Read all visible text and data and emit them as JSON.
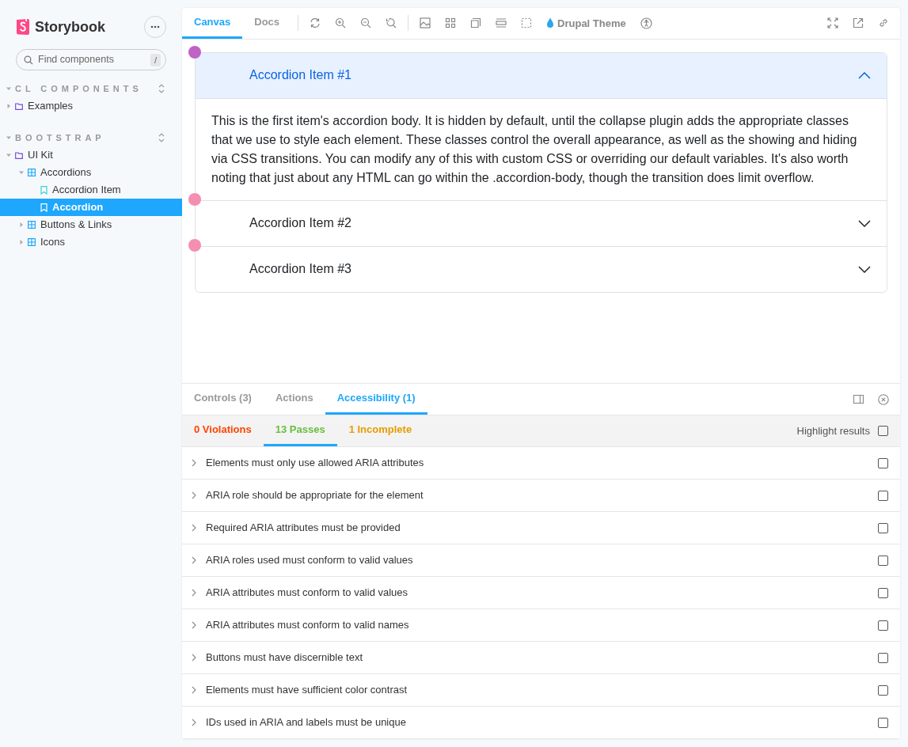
{
  "sidebar": {
    "brand": "Storybook",
    "search": {
      "placeholder": "Find components",
      "shortcut": "/"
    },
    "sections": [
      {
        "title": "CL COMPONENTS",
        "expanded": true,
        "items": [
          {
            "kind": "folder",
            "label": "Examples",
            "expanded": false,
            "selected": false
          }
        ]
      },
      {
        "title": "BOOTSTRAP",
        "expanded": true,
        "items": [
          {
            "kind": "folder",
            "label": "UI Kit",
            "expanded": true,
            "selected": false,
            "children": [
              {
                "kind": "component",
                "label": "Accordions",
                "expanded": true,
                "selected": false,
                "children": [
                  {
                    "kind": "story",
                    "label": "Accordion Item",
                    "selected": false
                  },
                  {
                    "kind": "story",
                    "label": "Accordion",
                    "selected": true
                  }
                ]
              },
              {
                "kind": "component",
                "label": "Buttons & Links",
                "expanded": false,
                "selected": false
              },
              {
                "kind": "component",
                "label": "Icons",
                "expanded": false,
                "selected": false
              }
            ]
          }
        ]
      }
    ]
  },
  "toolbar": {
    "tabs": [
      {
        "label": "Canvas",
        "selected": true
      },
      {
        "label": "Docs",
        "selected": false
      }
    ],
    "theme": "Drupal Theme"
  },
  "accordion": {
    "items": [
      {
        "title": "Accordion Item #1",
        "expanded": true,
        "color": "#c063c4",
        "body": "This is the first item's accordion body. It is hidden by default, until the collapse plugin adds the appropriate classes that we use to style each element. These classes control the overall appearance, as well as the showing and hiding via CSS transitions. You can modify any of this with custom CSS or overriding our default variables. It's also worth noting that just about any HTML can go within the .accordion-body, though the transition does limit overflow."
      },
      {
        "title": "Accordion Item #2",
        "expanded": false,
        "color": "#f48fb1"
      },
      {
        "title": "Accordion Item #3",
        "expanded": false,
        "color": "#f48fb1"
      }
    ]
  },
  "panel": {
    "tabs": [
      {
        "label": "Controls (3)",
        "selected": false
      },
      {
        "label": "Actions",
        "selected": false
      },
      {
        "label": "Accessibility (1)",
        "selected": true
      }
    ],
    "subtabs": [
      {
        "label": "0 Violations",
        "color": "#ff4400",
        "selected": false
      },
      {
        "label": "13 Passes",
        "color": "#66bf3c",
        "selected": true
      },
      {
        "label": "1 Incomplete",
        "color": "#e69d00",
        "selected": false
      }
    ],
    "highlight": {
      "label": "Highlight results",
      "checked": false
    },
    "rules": [
      {
        "label": "Elements must only use allowed ARIA attributes",
        "checked": false
      },
      {
        "label": "ARIA role should be appropriate for the element",
        "checked": false
      },
      {
        "label": "Required ARIA attributes must be provided",
        "checked": false
      },
      {
        "label": "ARIA roles used must conform to valid values",
        "checked": false
      },
      {
        "label": "ARIA attributes must conform to valid values",
        "checked": false
      },
      {
        "label": "ARIA attributes must conform to valid names",
        "checked": false
      },
      {
        "label": "Buttons must have discernible text",
        "checked": false
      },
      {
        "label": "Elements must have sufficient color contrast",
        "checked": false
      },
      {
        "label": "IDs used in ARIA and labels must be unique",
        "checked": false
      }
    ]
  }
}
